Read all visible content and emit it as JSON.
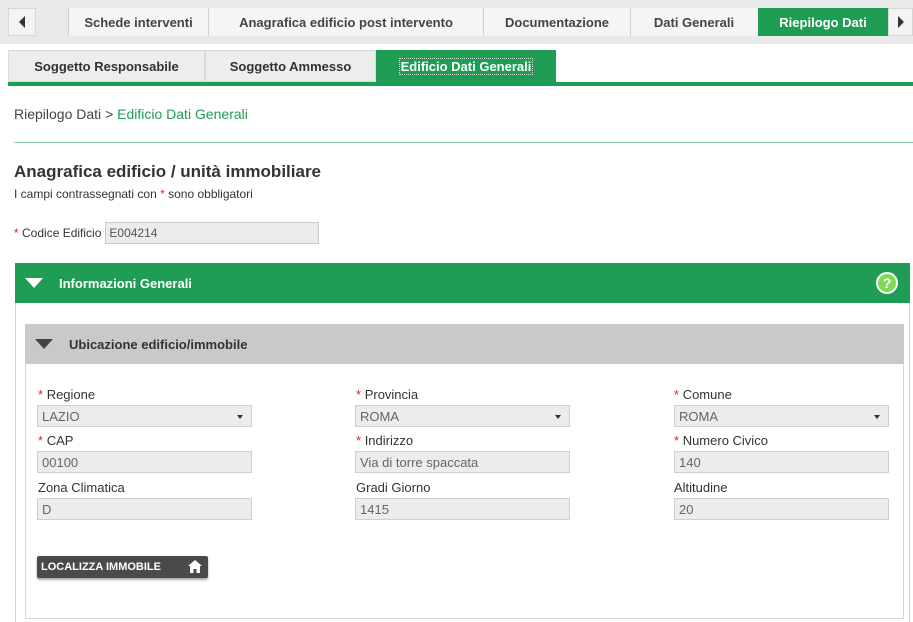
{
  "top_tabs": [
    {
      "label": "Schede interventi",
      "active": false
    },
    {
      "label": "Anagrafica edificio post intervento",
      "active": false
    },
    {
      "label": "Documentazione",
      "active": false
    },
    {
      "label": "Dati Generali",
      "active": false
    },
    {
      "label": "Riepilogo Dati",
      "active": true
    }
  ],
  "sub_tabs": [
    {
      "label": "Soggetto Responsabile",
      "active": false
    },
    {
      "label": "Soggetto Ammesso",
      "active": false
    },
    {
      "label": "Edificio Dati Generali",
      "active": true
    }
  ],
  "breadcrumb": {
    "root": "Riepilogo Dati",
    "separator": ">",
    "current": "Edificio Dati Generali"
  },
  "page": {
    "title": "Anagrafica edificio / unità immobiliare",
    "note_prefix": "I campi contrassegnati con",
    "note_asterisk": "*",
    "note_suffix": "sono obbligatori"
  },
  "codice_edificio": {
    "label": "Codice Edificio",
    "value": "E004214",
    "required": true
  },
  "section_info": {
    "title": "Informazioni Generali",
    "help": "?"
  },
  "section_ubicazione": {
    "title": "Ubicazione edificio/immobile",
    "fields": {
      "regione": {
        "label": "Regione",
        "value": "LAZIO",
        "required": true
      },
      "provincia": {
        "label": "Provincia",
        "value": "ROMA",
        "required": true
      },
      "comune": {
        "label": "Comune",
        "value": "ROMA",
        "required": true
      },
      "cap": {
        "label": "CAP",
        "value": "00100",
        "required": true
      },
      "indirizzo": {
        "label": "Indirizzo",
        "value": "Via di torre spaccata",
        "required": true
      },
      "numero_civico": {
        "label": "Numero Civico",
        "value": "140",
        "required": true
      },
      "zona_climatica": {
        "label": "Zona Climatica",
        "value": "D",
        "required": false
      },
      "gradi_giorno": {
        "label": "Gradi Giorno",
        "value": "1415",
        "required": false
      },
      "altitudine": {
        "label": "Altitudine",
        "value": "20",
        "required": false
      }
    },
    "locate_button": "LOCALIZZA IMMOBILE"
  },
  "colors": {
    "accent_green": "#1f9d55",
    "required_red": "#e2231a",
    "help_green": "#7ed957"
  }
}
